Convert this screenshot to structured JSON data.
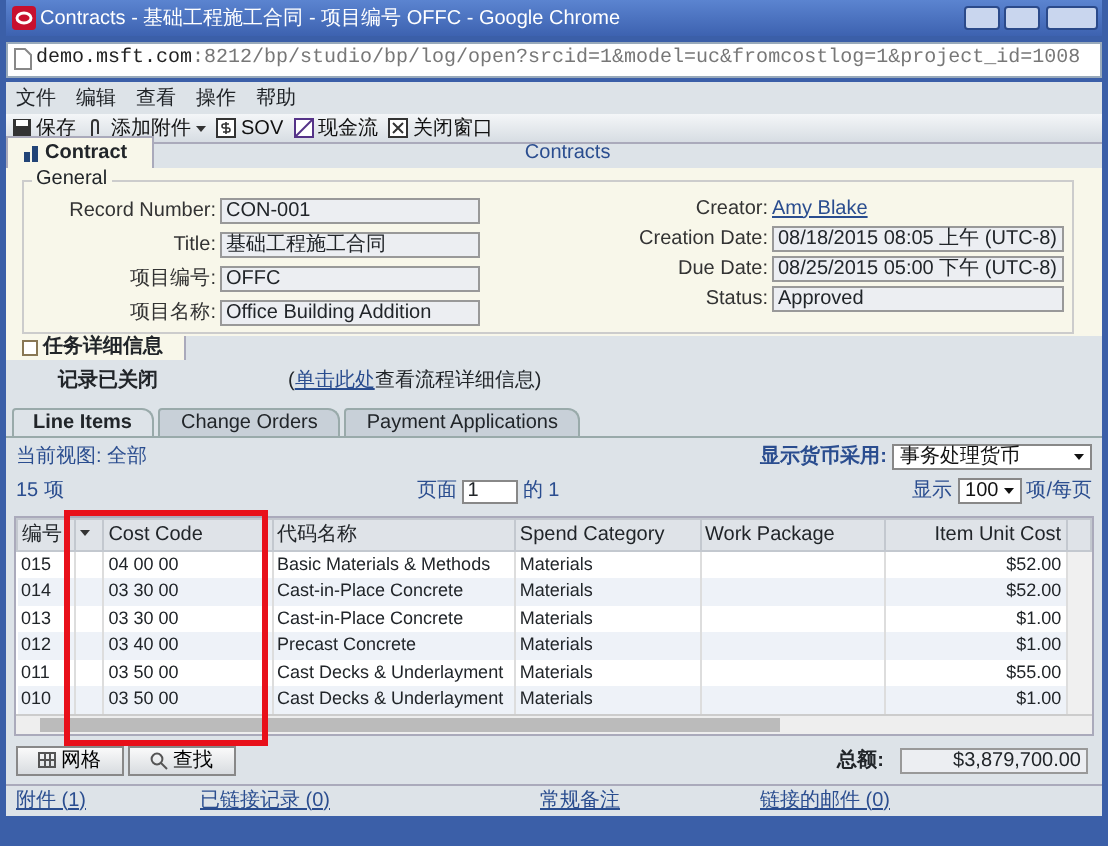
{
  "window": {
    "title": "Contracts - 基础工程施工合同 - 项目编号 OFFC - Google Chrome",
    "url_host": "demo.msft.com",
    "url_path": ":8212/bp/studio/bp/log/open?srcid=1&model=uc&fromcostlog=1&project_id=1008"
  },
  "menu": [
    "文件",
    "编辑",
    "查看",
    "操作",
    "帮助"
  ],
  "toolbar": [
    {
      "kind": "save",
      "label": "保存"
    },
    {
      "kind": "attach",
      "label": "添加附件",
      "dropdown": true
    },
    {
      "kind": "sov",
      "label": "SOV"
    },
    {
      "kind": "cash",
      "label": "现金流"
    },
    {
      "kind": "close",
      "label": "关闭窗口"
    }
  ],
  "form_tab": {
    "label": "Contract",
    "heading": "Contracts"
  },
  "general": {
    "legend": "General",
    "left": [
      {
        "label": "Record Number:",
        "value": "CON-001"
      },
      {
        "label": "Title:",
        "value": "基础工程施工合同"
      },
      {
        "label": "项目编号:",
        "value": "OFFC"
      },
      {
        "label": "项目名称:",
        "value": "Office Building Addition"
      }
    ],
    "right": [
      {
        "label": "Creator:",
        "value": "Amy Blake",
        "kind": "link"
      },
      {
        "label": "Creation Date:",
        "value": "08/18/2015 08:05 上午 (UTC-8)",
        "kind": "field"
      },
      {
        "label": "Due Date:",
        "value": "08/25/2015 05:00 下午 (UTC-8)",
        "kind": "field"
      },
      {
        "label": "Status:",
        "value": "Approved",
        "kind": "field"
      }
    ]
  },
  "task_tab": {
    "label": "任务详细信息",
    "status": "记录已关闭",
    "link_open": "(",
    "link": "单击此处",
    "link_rest": "查看流程详细信息)"
  },
  "tabs": [
    {
      "label": "Line Items",
      "selected": true
    },
    {
      "label": "Change Orders",
      "selected": false
    },
    {
      "label": "Payment Applications",
      "selected": false
    }
  ],
  "view": {
    "current": "当前视图: 全部",
    "currency_label": "显示货币采用:",
    "currency": "事务处理货币",
    "count": "15 项",
    "page_label": "页面",
    "page": "1",
    "of": "的 1",
    "show_label": "显示",
    "per_page": "100",
    "per_page_suffix": "项/每页"
  },
  "table": {
    "columns": [
      "编号",
      "Cost Code",
      "代码名称",
      "Spend Category",
      "Work Package",
      "Item Unit Cost"
    ],
    "rows": [
      [
        "015",
        "04 00 00",
        "Basic Materials & Methods",
        "Materials",
        "",
        "$52.00"
      ],
      [
        "014",
        "03 30 00",
        "Cast-in-Place Concrete",
        "Materials",
        "",
        "$52.00"
      ],
      [
        "013",
        "03 30 00",
        "Cast-in-Place Concrete",
        "Materials",
        "",
        "$1.00"
      ],
      [
        "012",
        "03 40 00",
        "Precast Concrete",
        "Materials",
        "",
        "$1.00"
      ],
      [
        "011",
        "03 50 00",
        "Cast Decks & Underlayment",
        "Materials",
        "",
        "$55.00"
      ],
      [
        "010",
        "03 50 00",
        "Cast Decks & Underlayment",
        "Materials",
        "",
        "$1.00"
      ]
    ]
  },
  "buttons": [
    {
      "kind": "grid",
      "label": "网格"
    },
    {
      "kind": "find",
      "label": "查找"
    }
  ],
  "total": {
    "label": "总额:",
    "value": "$3,879,700.00"
  },
  "footer_links": [
    "附件 (1)",
    "已链接记录 (0)",
    "常规备注",
    "链接的邮件 (0)"
  ]
}
